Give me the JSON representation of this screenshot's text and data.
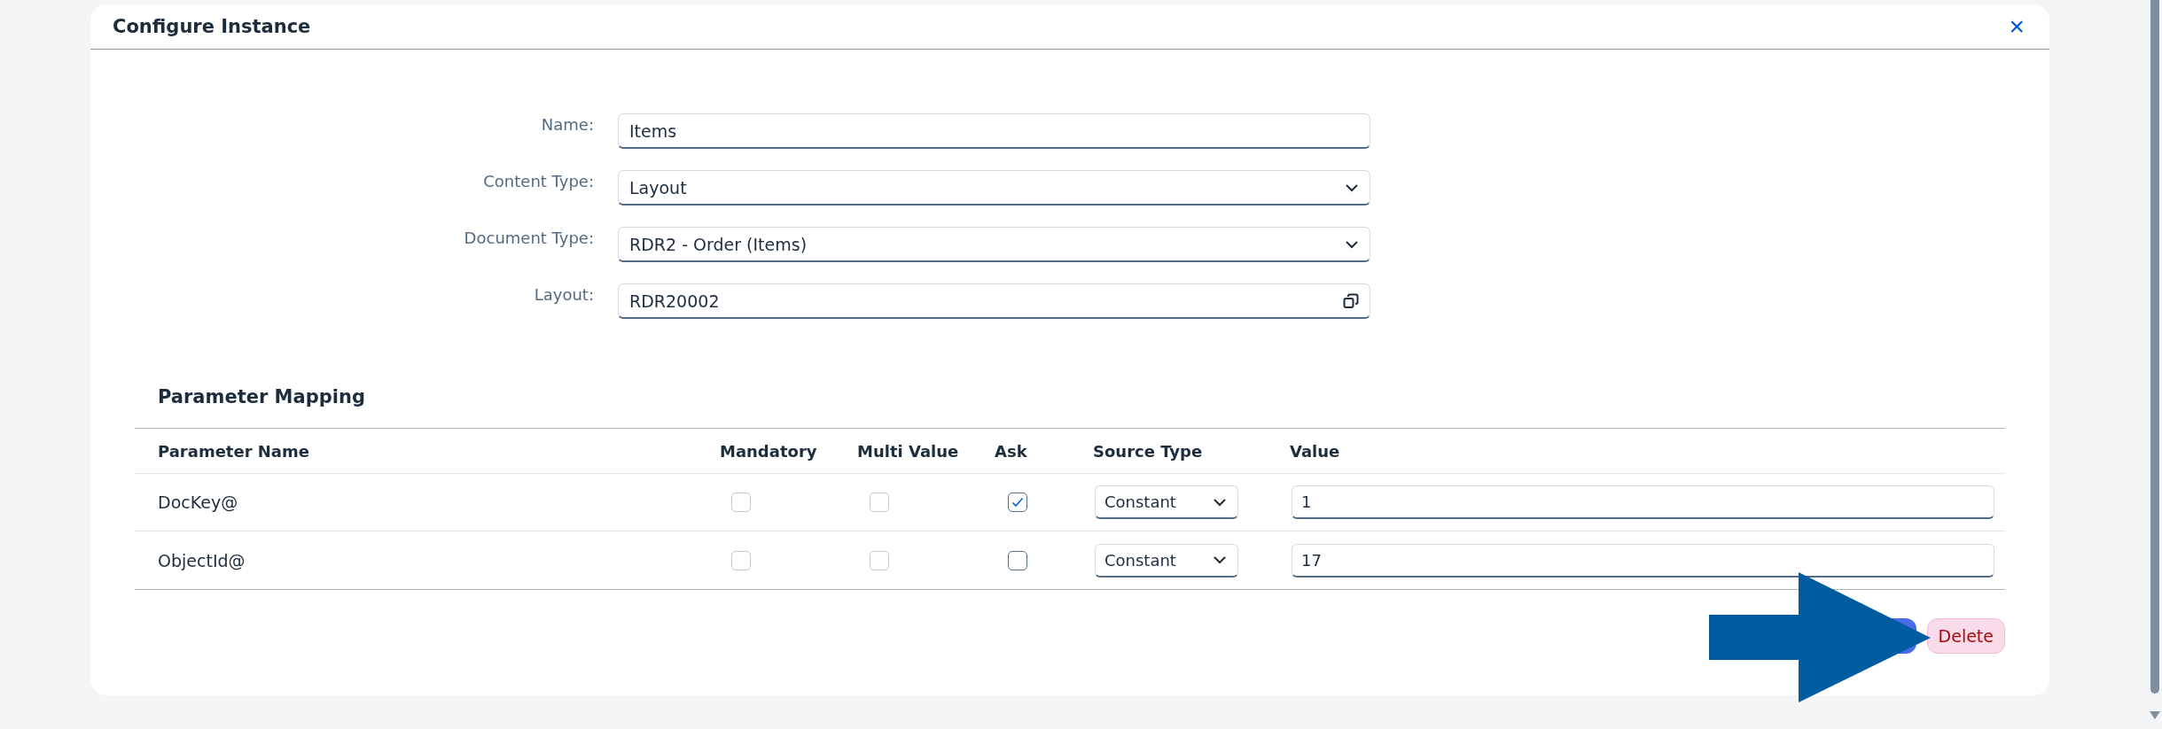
{
  "dialog": {
    "title": "Configure Instance",
    "close": "×"
  },
  "form": [
    {
      "label": "Name:",
      "kind": "text",
      "value": "Items"
    },
    {
      "label": "Content Type:",
      "kind": "select",
      "value": "Layout"
    },
    {
      "label": "Document Type:",
      "kind": "select",
      "value": "RDR2 - Order (Items)"
    },
    {
      "label": "Layout:",
      "kind": "lookup",
      "value": "RDR20002"
    }
  ],
  "parameter_mapping": {
    "title": "Parameter Mapping",
    "columns": [
      "Parameter Name",
      "Mandatory",
      "Multi Value",
      "Ask",
      "Source Type",
      "Value"
    ],
    "rows": [
      {
        "name": "DocKey@",
        "mandatory": {
          "checked": false,
          "disabled": true
        },
        "multi_value": {
          "checked": false,
          "disabled": true
        },
        "ask": {
          "checked": true,
          "disabled": false
        },
        "source_type": "Constant",
        "value": "1"
      },
      {
        "name": "ObjectId@",
        "mandatory": {
          "checked": false,
          "disabled": true
        },
        "multi_value": {
          "checked": false,
          "disabled": true
        },
        "ask": {
          "checked": false,
          "disabled": false
        },
        "source_type": "Constant",
        "value": "17"
      }
    ]
  },
  "buttons": [
    {
      "kind": "primary"
    },
    {
      "kind": "delete",
      "label": "Delete"
    }
  ]
}
